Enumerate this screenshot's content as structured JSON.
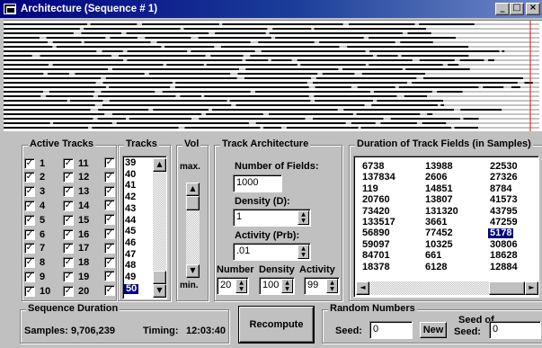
{
  "window": {
    "title": "Architecture (Sequence # 1)",
    "controls": {
      "minimize": "_",
      "maximize": "□",
      "close": "×"
    }
  },
  "active_tracks": {
    "title": "Active Tracks",
    "checked_symbol": "✓",
    "col1": [
      "1",
      "2",
      "3",
      "4",
      "5",
      "6",
      "7",
      "8",
      "9",
      "10"
    ],
    "col2": [
      "11",
      "12",
      "13",
      "14",
      "15",
      "16",
      "17",
      "18",
      "19",
      "20"
    ]
  },
  "tracks_list": {
    "title": "Tracks",
    "items": [
      "39",
      "40",
      "41",
      "42",
      "43",
      "44",
      "45",
      "46",
      "47",
      "48",
      "49",
      "50"
    ],
    "selected": "50"
  },
  "volume": {
    "title": "Vol",
    "max_label": "max.",
    "min_label": "min."
  },
  "track_architecture": {
    "title": "Track Architecture",
    "number_of_fields_label": "Number of Fields:",
    "number_of_fields": "1000",
    "density_label": "Density (D):",
    "density": "1",
    "activity_label": "Activity (Prb):",
    "activity": ".01",
    "footer_labels": [
      "Number",
      "Density",
      "Activity"
    ],
    "footer_values": [
      "20",
      "100",
      "99"
    ]
  },
  "durations": {
    "title": "Duration of Track Fields (in Samples)",
    "columns": [
      [
        "6738",
        "137834",
        "119",
        "20760",
        "73420",
        "133517",
        "56890",
        "59097",
        "84701",
        "18378"
      ],
      [
        "13988",
        "2606",
        "14851",
        "13807",
        "131320",
        "3661",
        "77452",
        "10325",
        "661",
        "6128"
      ],
      [
        "22530",
        "27326",
        "8784",
        "41573",
        "43795",
        "47259",
        "5178",
        "30806",
        "18628",
        "12884"
      ]
    ],
    "selected": "5178"
  },
  "sequence": {
    "title": "Sequence Duration",
    "samples_label": "Samples:",
    "samples": "9,706,239",
    "timing_label": "Timing:",
    "timing": "12:03:40"
  },
  "recompute_label": "Recompute",
  "random": {
    "title": "Random Numbers",
    "seed_label": "Seed:",
    "seed": "0",
    "new_label": "New",
    "seed_of_label": "Seed of",
    "seed_of_seed_label": "Seed:",
    "seed_of_seed": "0"
  },
  "colors": {
    "title_bar": "#000080",
    "face": "#c0c0c0",
    "selection": "#000080",
    "cursor_line": "#ff0000"
  }
}
